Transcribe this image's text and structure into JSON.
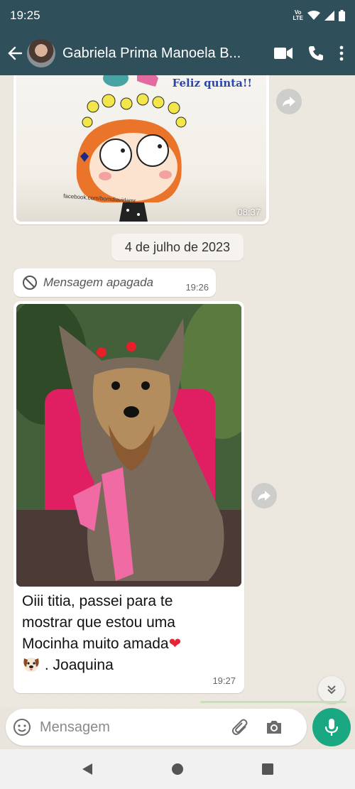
{
  "status": {
    "time": "19:25",
    "volte_top": "Vo",
    "volte_bottom": "LTE"
  },
  "header": {
    "contact_name": "Gabriela Prima Manoela B..."
  },
  "messages": {
    "image1": {
      "overlay_text": "Feliz quinta!!",
      "source_text": "facebook.com/bomdiavidamr",
      "time": "08:37"
    },
    "date_separator": "4 de julho de 2023",
    "deleted": {
      "text": "Mensagem apagada",
      "time": "19:26"
    },
    "photo": {
      "caption_line1": "Oiii titia, passei para te",
      "caption_line2": "mostrar que estou uma",
      "caption_line3": "Mocinha muito amada",
      "heart": "❤",
      "signature": ". Joaquina",
      "time": "19:27"
    }
  },
  "composer": {
    "placeholder": "Mensagem"
  },
  "colors": {
    "header": "#2f4f5b",
    "accent": "#1aa883",
    "chat_bg": "#ece7df"
  }
}
